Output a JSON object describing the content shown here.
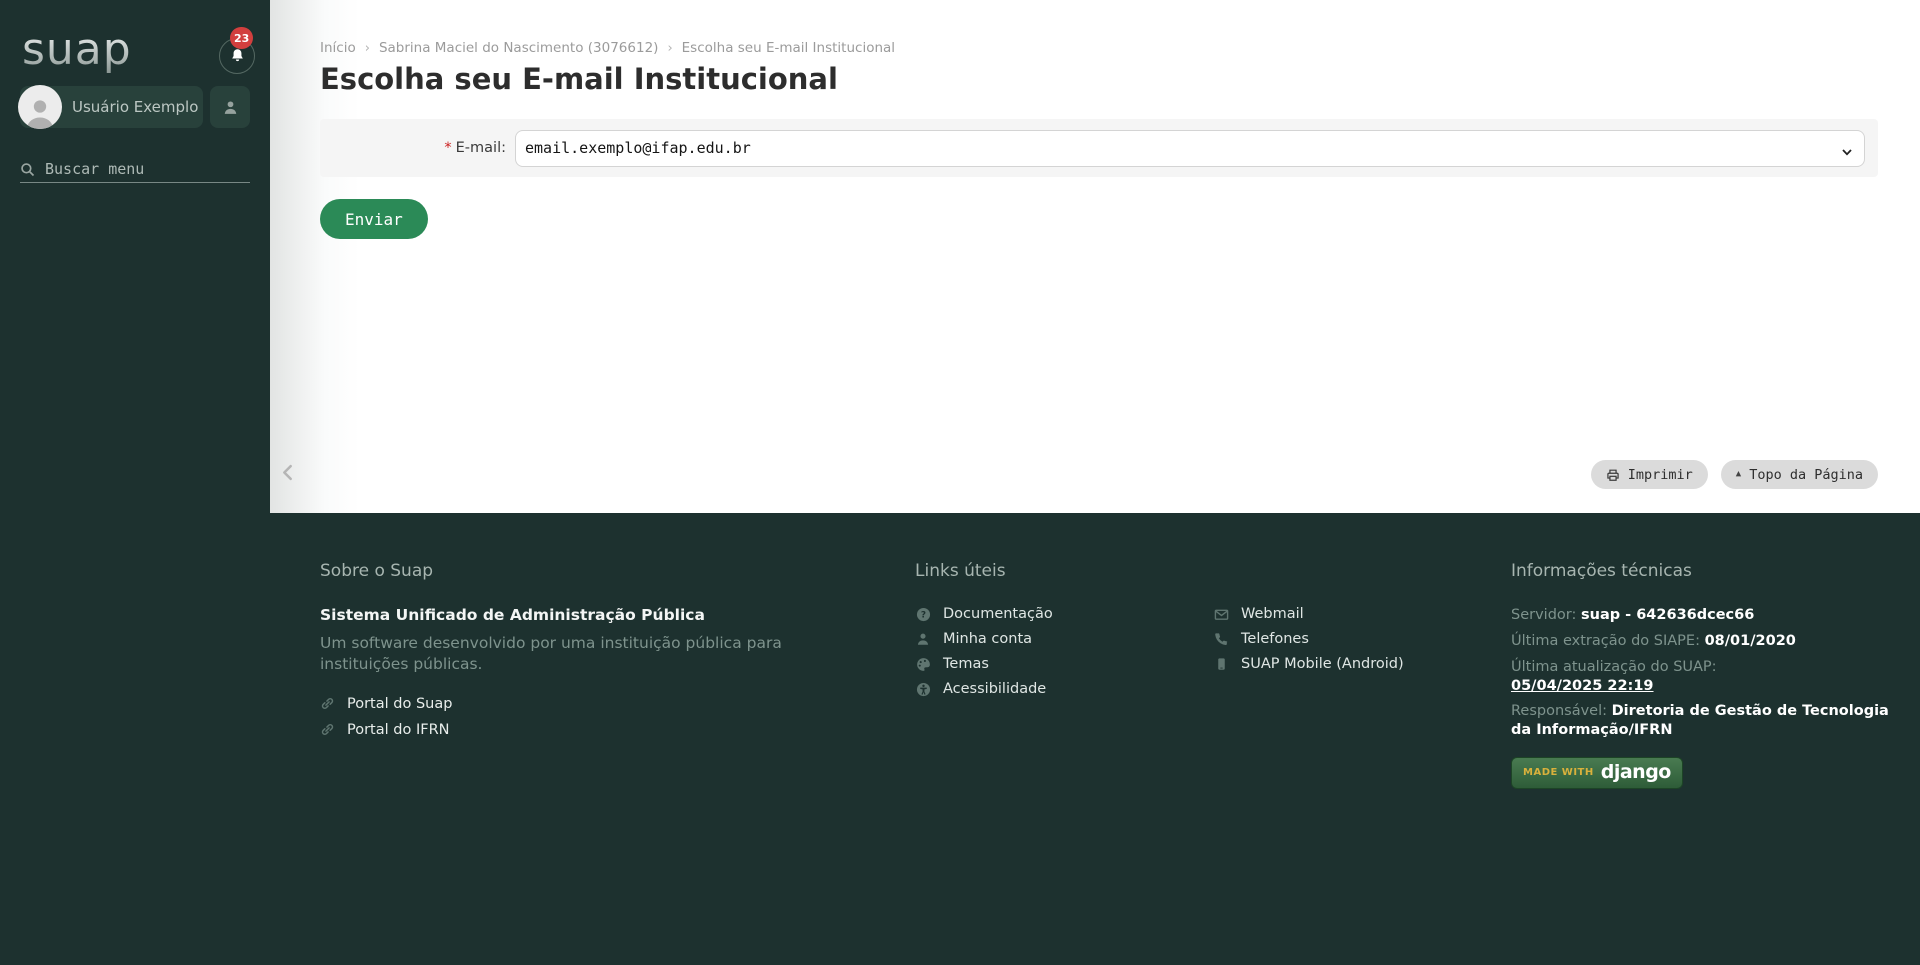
{
  "sidebar": {
    "logo": "suap",
    "notification_count": "23",
    "user_name": "Usuário Exemplo",
    "search_placeholder": "Buscar menu"
  },
  "breadcrumb": {
    "items": [
      "Início",
      "Sabrina Maciel do Nascimento (3076612)",
      "Escolha seu E-mail Institucional"
    ]
  },
  "page": {
    "title": "Escolha seu E-mail Institucional",
    "form": {
      "required_marker": "*",
      "email_label": "E-mail:",
      "email_value": "email.exemplo@ifap.edu.br",
      "submit_label": "Enviar"
    },
    "actions": {
      "print_label": "Imprimir",
      "top_label": "Topo da Página"
    }
  },
  "footer": {
    "about": {
      "heading": "Sobre o Suap",
      "title": "Sistema Unificado de Administração Pública",
      "description": "Um software desenvolvido por uma instituição pública para instituições públicas.",
      "links": [
        {
          "icon": "link-icon",
          "label": "Portal do Suap"
        },
        {
          "icon": "link-icon",
          "label": "Portal do IFRN"
        }
      ]
    },
    "useful_links": {
      "heading": "Links úteis",
      "col1": [
        {
          "icon": "help-icon",
          "label": "Documentação"
        },
        {
          "icon": "user-icon",
          "label": "Minha conta"
        },
        {
          "icon": "palette-icon",
          "label": "Temas"
        },
        {
          "icon": "accessibility-icon",
          "label": "Acessibilidade"
        }
      ],
      "col2": [
        {
          "icon": "mail-icon",
          "label": "Webmail"
        },
        {
          "icon": "phone-icon",
          "label": "Telefones"
        },
        {
          "icon": "mobile-icon",
          "label": "SUAP Mobile (Android)"
        }
      ]
    },
    "tech_info": {
      "heading": "Informações técnicas",
      "rows": [
        {
          "label": "Servidor:",
          "value": "suap - 642636dcec66"
        },
        {
          "label": "Última extração do SIAPE:",
          "value": "08/01/2020"
        },
        {
          "label": "Última atualização do SUAP:",
          "value": "05/04/2025 22:19"
        },
        {
          "label": "Responsável:",
          "value": "Diretoria de Gestão de Tecnologia da Informação/IFRN"
        }
      ],
      "badge": {
        "prefix": "MADE WITH",
        "name": "django"
      }
    }
  },
  "colors": {
    "sidebar_bg": "#1d312f",
    "accent_green": "#2b8a57",
    "badge_red": "#d23f3e",
    "django_gold": "#d9b13c"
  }
}
